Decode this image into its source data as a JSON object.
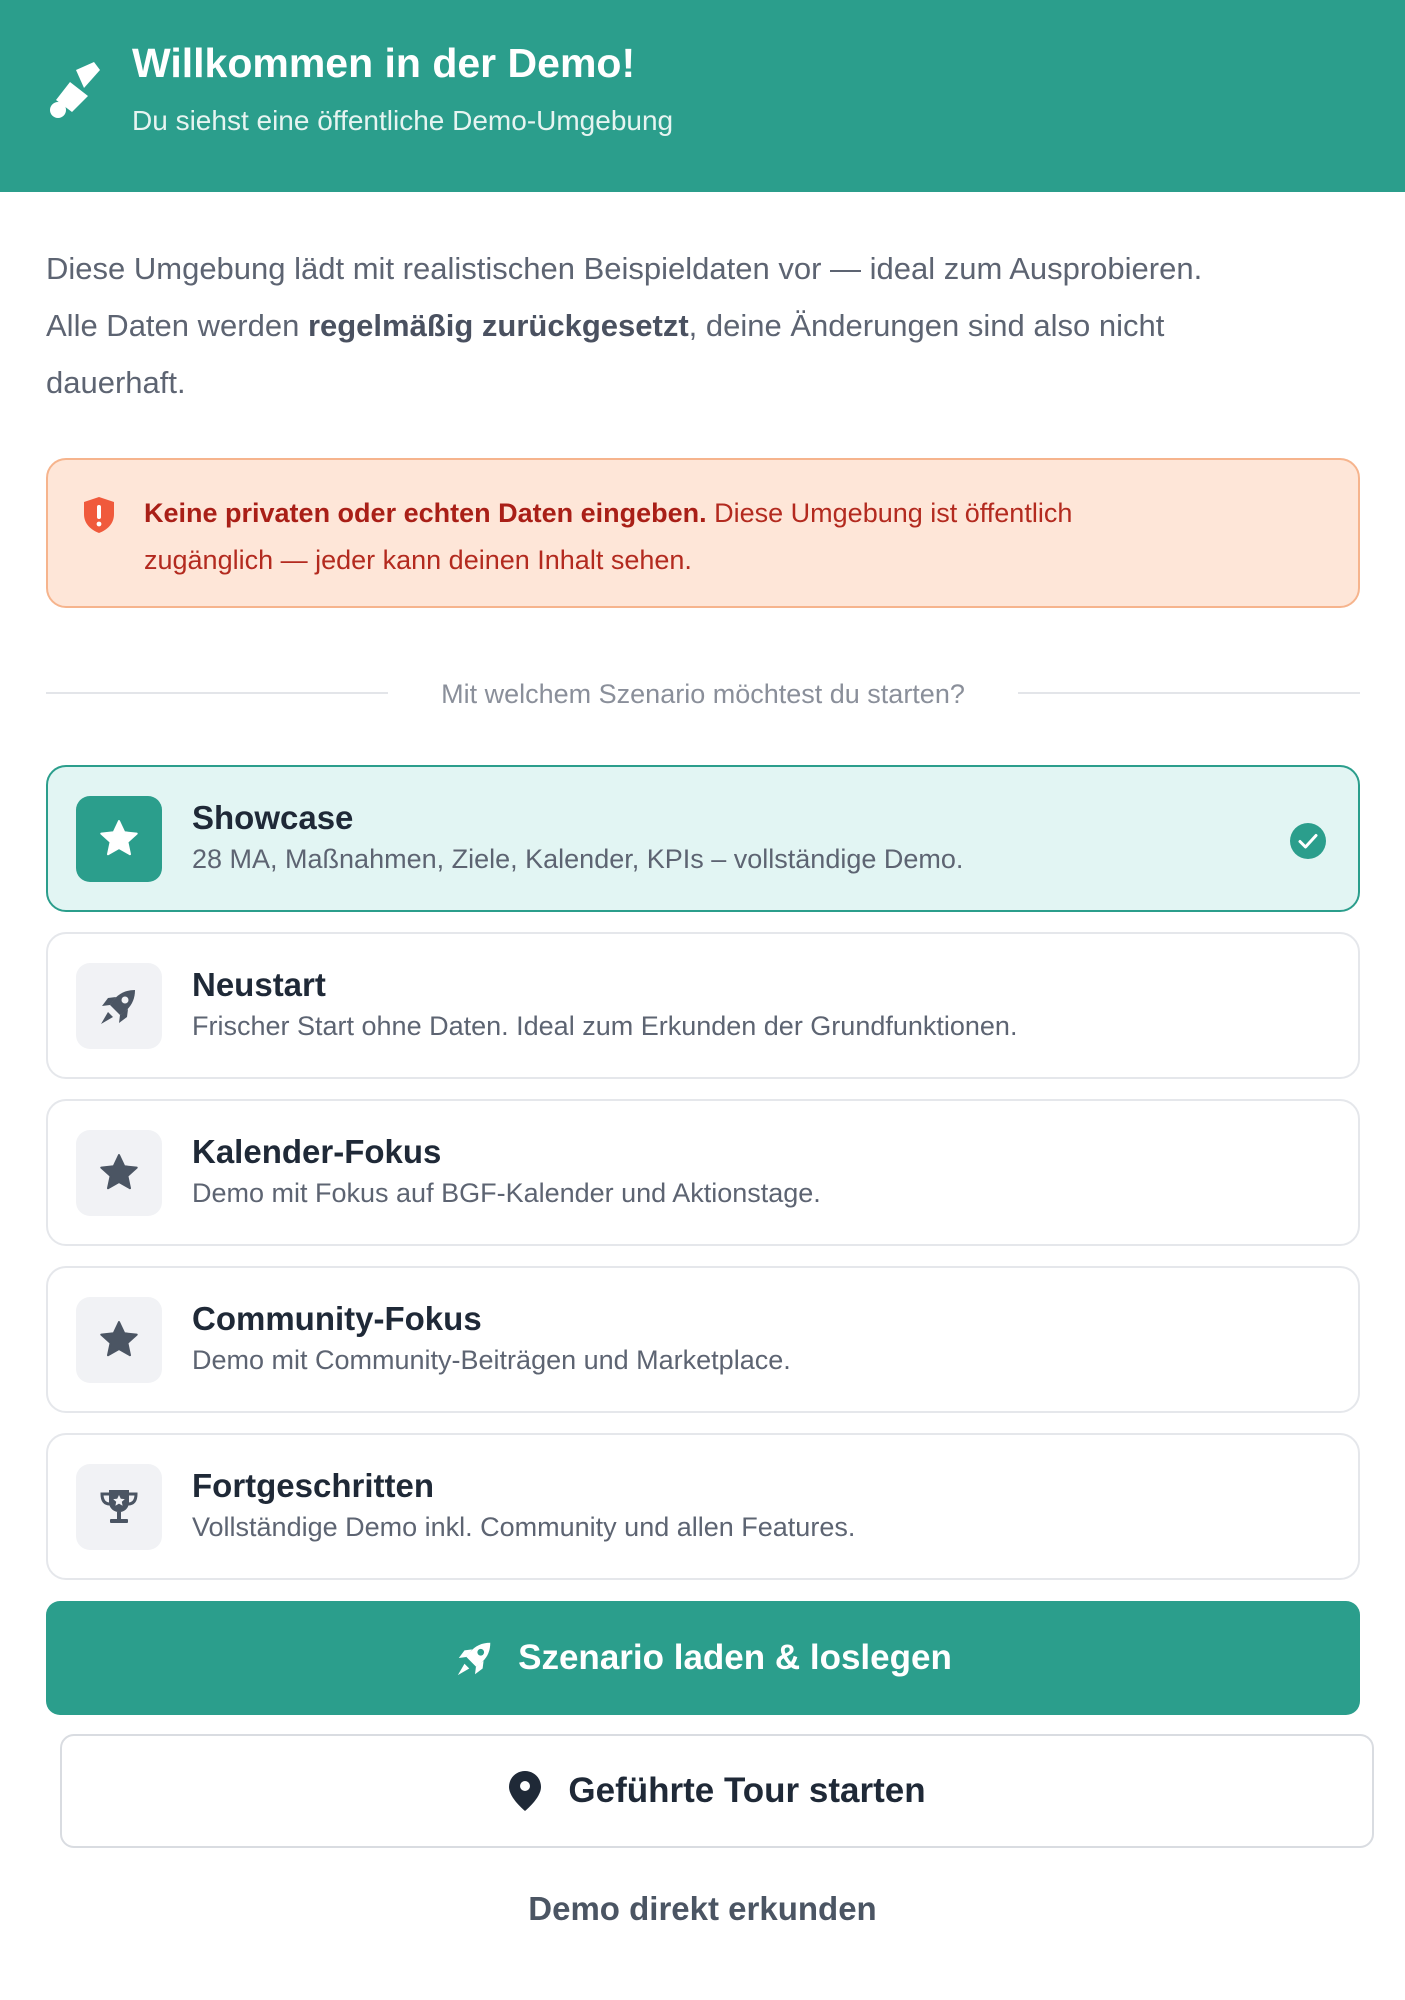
{
  "header": {
    "title": "Willkommen in der Demo!",
    "subtitle": "Du siehst eine öffentliche Demo-Umgebung",
    "icon": "paint-brush-icon"
  },
  "intro": {
    "line1": "Diese Umgebung lädt mit realistischen Beispieldaten vor — ideal zum Ausprobieren.",
    "line2_before": "Alle Daten werden ",
    "line2_bold": "regelmäßig zurückgesetzt",
    "line2_after": ", deine Änderungen sind also nicht",
    "line3": "dauerhaft."
  },
  "warning": {
    "icon": "shield-alert-icon",
    "bold": "Keine privaten oder echten Daten eingeben.",
    "text_line1": " Diese Umgebung ist öffentlich",
    "text_line2": "zugänglich — jeder kann deinen Inhalt sehen."
  },
  "scenario_prompt": "Mit welchem Szenario möchtest du starten?",
  "scenarios": [
    {
      "title": "Showcase",
      "description": "28 MA, Maßnahmen, Ziele, Kalender, KPIs – vollständige Demo.",
      "icon": "star-icon",
      "selected": true
    },
    {
      "title": "Neustart",
      "description": "Frischer Start ohne Daten. Ideal zum Erkunden der Grundfunktionen.",
      "icon": "rocket-icon",
      "selected": false
    },
    {
      "title": "Kalender-Fokus",
      "description": "Demo mit Fokus auf BGF-Kalender und Aktionstage.",
      "icon": "star-icon",
      "selected": false
    },
    {
      "title": "Community-Fokus",
      "description": "Demo mit Community-Beiträgen und Marketplace.",
      "icon": "star-icon",
      "selected": false
    },
    {
      "title": "Fortgeschritten",
      "description": "Vollständige Demo inkl. Community und allen Features.",
      "icon": "trophy-icon",
      "selected": false
    }
  ],
  "actions": {
    "primary_label": "Szenario laden & loslegen",
    "primary_icon": "rocket-icon",
    "secondary_label": "Geführte Tour starten",
    "secondary_icon": "map-pin-icon",
    "link_label": "Demo direkt erkunden"
  },
  "colors": {
    "brand": "#2b9e8c",
    "warning_bg": "#fee6d8",
    "warning_text": "#b32a1f",
    "selected_bg": "#e2f5f3"
  }
}
